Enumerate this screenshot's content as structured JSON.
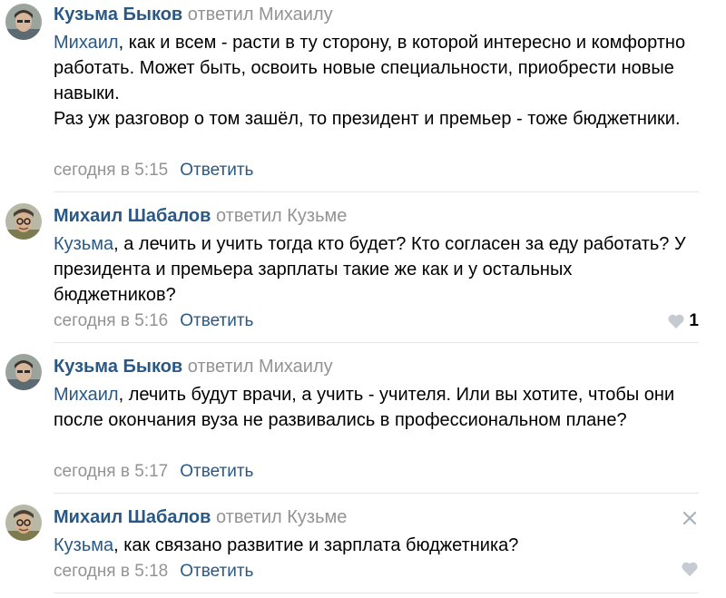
{
  "comments": [
    {
      "author": "Кузьма Быков",
      "replied_to": "ответил Михаилу",
      "mention": "Михаил",
      "text_line1": ", как и всем - расти в ту сторону, в которой интересно и комфортно работать. Может быть, освоить новые специальности, приобрести новые навыки.",
      "text_line2": "Раз уж разговор о том зашёл, то президент и премьер - тоже бюджетники.",
      "date": "сегодня в 5:15",
      "reply_label": "Ответить"
    },
    {
      "author": "Михаил Шабалов",
      "replied_to": "ответил Кузьме",
      "mention": "Кузьма",
      "text_line1": ", а лечить и учить тогда кто будет? Кто согласен за еду работать? У президента и премьера зарплаты такие же как и у остальных бюджетников?",
      "date": "сегодня в 5:16",
      "reply_label": "Ответить",
      "like_count": "1",
      "like_icon": "heart-icon"
    },
    {
      "author": "Кузьма Быков",
      "replied_to": "ответил Михаилу",
      "mention": "Михаил",
      "text_line1": ", лечить будут врачи, а учить - учителя. Или вы хотите, чтобы они после окончания вуза не развивались в профессиональном плане?",
      "date": "сегодня в 5:17",
      "reply_label": "Ответить"
    },
    {
      "author": "Михаил Шабалов",
      "replied_to": "ответил Кузьме",
      "mention": "Кузьма",
      "text_line1": ", как связано развитие и зарплата бюджетника?",
      "date": "сегодня в 5:18",
      "reply_label": "Ответить",
      "like_icon": "heart-icon",
      "delete_icon": "close-icon"
    }
  ],
  "colors": {
    "link": "#2a5885",
    "secondary": "#939393",
    "divider": "#e3e5e8",
    "heart": "#c5cbd1"
  }
}
